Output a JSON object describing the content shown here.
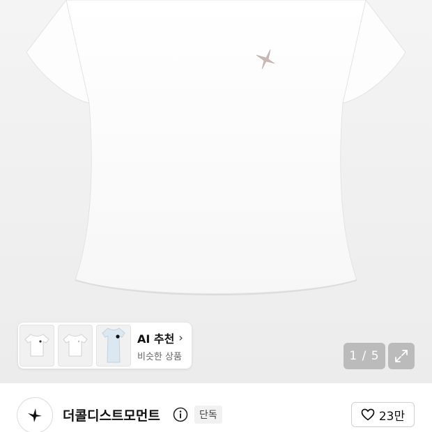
{
  "gallery": {
    "counter": "1 / 5",
    "expand_icon": "expand-icon",
    "thumbnails": [
      "white-tshirt-front",
      "white-tshirt-front-alt",
      "light-blue-tshirt"
    ]
  },
  "ai_reco": {
    "title": "AI 추천",
    "subtitle": "비슷한 상품",
    "chevron_icon": "chevron-right-icon"
  },
  "brand": {
    "name": "더콜디스트모먼트",
    "badge": "단독",
    "logo_icon": "starfish-logo-icon",
    "info_icon": "info-icon"
  },
  "likes": {
    "count": "23만",
    "icon": "heart-outline-icon"
  },
  "colors": {
    "background": "#ececec",
    "tshirt": "#ffffff",
    "logo_embroidery": "#c9b8b6"
  }
}
